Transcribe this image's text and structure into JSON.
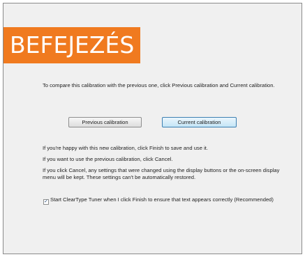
{
  "banner": {
    "title": "BEFEJEZÉS"
  },
  "dialog": {
    "intro": "To compare this calibration with the previous one, click Previous calibration and Current calibration.",
    "buttons": {
      "previous_label": "Previous calibration",
      "current_label": "Current calibration"
    },
    "info": [
      "If you're happy with this new calibration, click Finish to save and use it.",
      "If you want to use the previous calibration, click Cancel.",
      "If you click Cancel, any settings that were changed using the display buttons or the on-screen display menu will be kept. These settings can't be automatically restored."
    ],
    "checkbox": {
      "label": "Start ClearType Tuner when I click Finish to ensure that text appears correctly (Recommended)",
      "checked": true,
      "check_glyph": "✓"
    }
  },
  "colors": {
    "banner_bg": "#f07a1f",
    "window_bg": "#f0f0f0",
    "accent_button_border": "#3c7fb1"
  }
}
